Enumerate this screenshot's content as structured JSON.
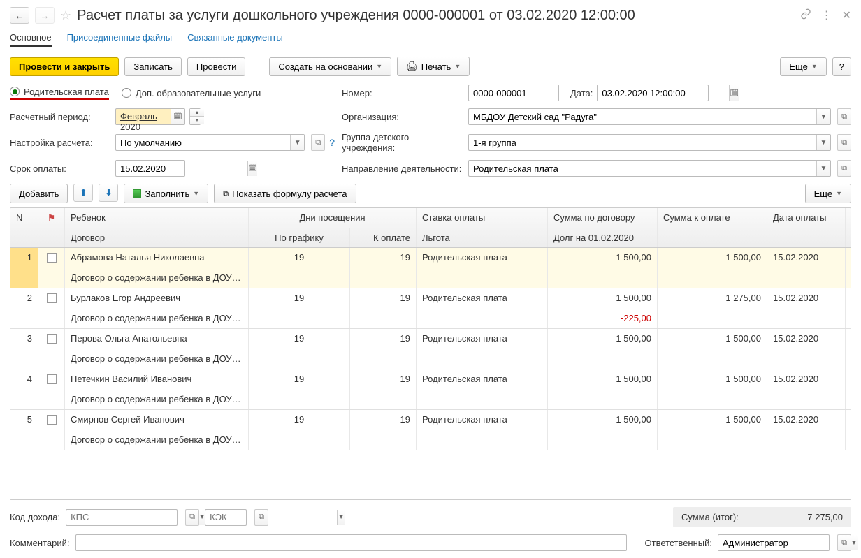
{
  "header": {
    "title": "Расчет платы за услуги дошкольного учреждения 0000-000001 от 03.02.2020 12:00:00"
  },
  "tabs": {
    "main": "Основное",
    "files": "Присоединенные файлы",
    "links": "Связанные документы"
  },
  "toolbar": {
    "post_close": "Провести и закрыть",
    "save": "Записать",
    "post": "Провести",
    "create_based": "Создать на основании",
    "print": "Печать",
    "more": "Еще",
    "help": "?"
  },
  "radios": {
    "parent_fee": "Родительская плата",
    "extra_services": "Доп. образовательные услуги"
  },
  "form": {
    "period_label": "Расчетный период:",
    "period_value": "Февраль 2020",
    "number_label": "Номер:",
    "number_value": "0000-000001",
    "date_label": "Дата:",
    "date_value": "03.02.2020 12:00:00",
    "settings_label": "Настройка расчета:",
    "settings_value": "По умолчанию",
    "org_label": "Организация:",
    "org_value": "МБДОУ Детский сад \"Радуга\"",
    "group_label": "Группа детского учреждения:",
    "group_value": "1-я группа",
    "due_label": "Срок оплаты:",
    "due_value": "15.02.2020",
    "activity_label": "Направление деятельности:",
    "activity_value": "Родительская плата"
  },
  "table_toolbar": {
    "add": "Добавить",
    "fill": "Заполнить",
    "show_formula": "Показать формулу расчета",
    "more": "Еще"
  },
  "grid": {
    "h_n": "N",
    "h_child": "Ребенок",
    "h_contract": "Договор",
    "h_days": "Дни посещения",
    "h_sched": "По графику",
    "h_pay": "К оплате",
    "h_rate": "Ставка оплаты",
    "h_benefit": "Льгота",
    "h_sum_contract": "Сумма по договору",
    "h_debt": "Долг на 01.02.2020",
    "h_sum_pay": "Сумма к оплате",
    "h_pay_date": "Дата оплаты",
    "rows": [
      {
        "n": "1",
        "child": "Абрамова Наталья Николаевна",
        "contract": "Договор о содержании ребенка в ДОУ…",
        "sched": "19",
        "topay": "19",
        "rate": "Родительская плата",
        "sum_contract": "1 500,00",
        "debt": "",
        "sum_pay": "1 500,00",
        "date": "15.02.2020"
      },
      {
        "n": "2",
        "child": "Бурлаков Егор Андреевич",
        "contract": "Договор о содержании ребенка в ДОУ…",
        "sched": "19",
        "topay": "19",
        "rate": "Родительская плата",
        "sum_contract": "1 500,00",
        "debt": "-225,00",
        "sum_pay": "1 275,00",
        "date": "15.02.2020"
      },
      {
        "n": "3",
        "child": "Перова Ольга Анатольевна",
        "contract": "Договор о содержании ребенка в ДОУ…",
        "sched": "19",
        "topay": "19",
        "rate": "Родительская плата",
        "sum_contract": "1 500,00",
        "debt": "",
        "sum_pay": "1 500,00",
        "date": "15.02.2020"
      },
      {
        "n": "4",
        "child": "Петечкин Василий Иванович",
        "contract": "Договор о содержании ребенка в ДОУ…",
        "sched": "19",
        "topay": "19",
        "rate": "Родительская плата",
        "sum_contract": "1 500,00",
        "debt": "",
        "sum_pay": "1 500,00",
        "date": "15.02.2020"
      },
      {
        "n": "5",
        "child": "Смирнов Сергей Иванович",
        "contract": "Договор о содержании ребенка в ДОУ…",
        "sched": "19",
        "topay": "19",
        "rate": "Родительская плата",
        "sum_contract": "1 500,00",
        "debt": "",
        "sum_pay": "1 500,00",
        "date": "15.02.2020"
      }
    ]
  },
  "footer": {
    "income_code_label": "Код дохода:",
    "kps_placeholder": "КПС",
    "kek_placeholder": "КЭК",
    "total_label": "Сумма (итог):",
    "total_value": "7 275,00",
    "comment_label": "Комментарий:",
    "responsible_label": "Ответственный:",
    "responsible_value": "Администратор"
  }
}
